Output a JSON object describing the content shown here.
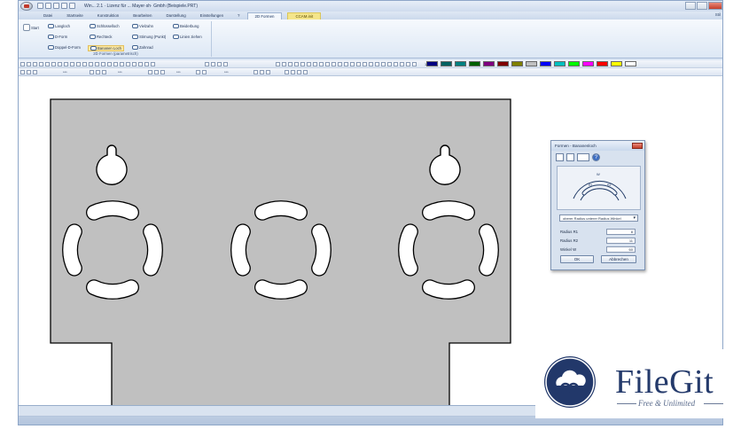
{
  "window": {
    "title": "Win... 2.1 · Lizenz für ... Mayer·sh· Gmbh (Beispiele.PRT)"
  },
  "tabs": [
    {
      "label": "Datei"
    },
    {
      "label": "Startseite"
    },
    {
      "label": "Konstruktion"
    },
    {
      "label": "Bearbeiten"
    },
    {
      "label": "Darstellung"
    },
    {
      "label": "Einstellungen"
    },
    {
      "label": "2D Formen"
    }
  ],
  "contextual_tab": {
    "label": "CCAM.init"
  },
  "active_tab": "2D Formen",
  "style_label": "Stil",
  "ribbon": {
    "start_label": "Start",
    "buttons": [
      {
        "label": "Langloch"
      },
      {
        "label": "D-Form"
      },
      {
        "label": "Doppel-D-Form"
      },
      {
        "label": "Schlüsselloch"
      },
      {
        "label": "Rechteck"
      },
      {
        "label": "Bananen Loch"
      },
      {
        "label": "Vielzahn"
      },
      {
        "label": "Stirnung (Punkt)"
      },
      {
        "label": "Zahnrad"
      },
      {
        "label": "Beiderbung"
      },
      {
        "label": "Linien ziehen"
      }
    ],
    "group_label": "2D Formen (parametrisch)"
  },
  "toolbar2": {
    "readouts": [
      "***",
      "***",
      "***",
      "***"
    ],
    "zoom": "1:1"
  },
  "palette": {
    "colors": [
      "#000080",
      "#006060",
      "#008080",
      "#006000",
      "#800080",
      "#800000",
      "#808000",
      "#c0c0c0",
      "#0000ff",
      "#00c0c0",
      "#00ff00",
      "#ff00ff",
      "#ff0000",
      "#ffff00",
      "#ffffff"
    ]
  },
  "part": {
    "fill": "#c0c0c0",
    "stroke": "#000000"
  },
  "dialog": {
    "title": "Formen - Bananenloch",
    "dropdown": "oberer Radius unterer Radius Winkel",
    "fields": [
      {
        "label": "Radius R1",
        "value": "8"
      },
      {
        "label": "Radius R2",
        "value": "11"
      },
      {
        "label": "Winkel W",
        "value": "60"
      }
    ],
    "ok_label": "OK",
    "cancel_label": "Abbrechen",
    "preview_labels": {
      "r1": "R1",
      "r2": "R2",
      "w": "W"
    }
  },
  "watermark": {
    "title": "FileGit",
    "subtitle": "Free & Unlimited"
  }
}
